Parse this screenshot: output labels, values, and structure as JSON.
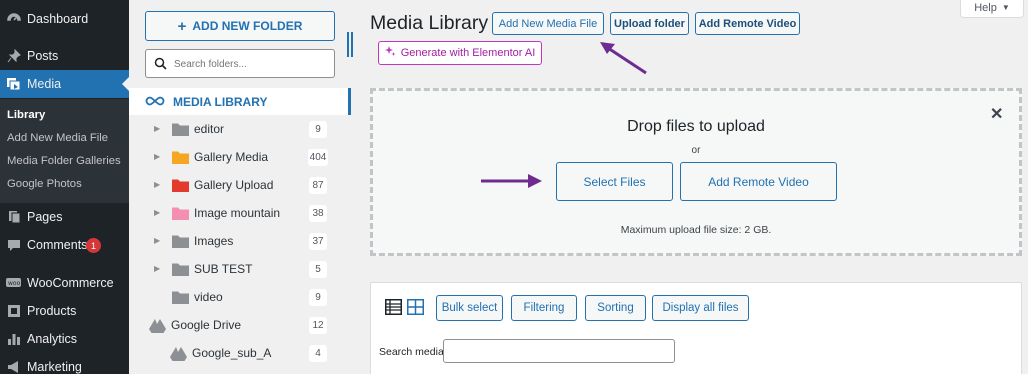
{
  "colors": {
    "accent": "#2271b1",
    "sidebar_bg": "#1d2327",
    "annotation": "#6e2c91",
    "elementor": "#c036c0"
  },
  "admin_menu": {
    "items": [
      {
        "label": "Dashboard",
        "icon": "dashboard-icon"
      },
      {
        "label": "Posts",
        "icon": "pin-icon"
      },
      {
        "label": "Media",
        "icon": "media-icon"
      },
      {
        "label": "Pages",
        "icon": "page-icon"
      },
      {
        "label": "Comments",
        "icon": "comment-icon",
        "badge": "1"
      },
      {
        "label": "WooCommerce",
        "icon": "woocommerce-icon"
      },
      {
        "label": "Products",
        "icon": "products-icon"
      },
      {
        "label": "Analytics",
        "icon": "analytics-icon"
      },
      {
        "label": "Marketing",
        "icon": "marketing-icon"
      }
    ],
    "submenu": [
      "Library",
      "Add New Media File",
      "Media Folder Galleries",
      "Google Photos"
    ]
  },
  "folders": {
    "add_button": "ADD NEW FOLDER",
    "search_placeholder": "Search folders...",
    "media_library": "MEDIA LIBRARY",
    "items": [
      {
        "label": "editor",
        "count": "9",
        "color": "#8c8f94"
      },
      {
        "label": "Gallery Media",
        "count": "404",
        "color": "#f5a623"
      },
      {
        "label": "Gallery Upload",
        "count": "87",
        "color": "#e23b2e"
      },
      {
        "label": "Image mountain",
        "count": "38",
        "color": "#f48fb1"
      },
      {
        "label": "Images",
        "count": "37",
        "color": "#8c8f94"
      },
      {
        "label": "SUB TEST",
        "count": "5",
        "color": "#8c8f94"
      },
      {
        "label": "video",
        "count": "9",
        "color": "#8c8f94"
      }
    ],
    "google_drive": {
      "label": "Google Drive",
      "count": "12"
    },
    "google_sub": {
      "label": "Google_sub_A",
      "count": "4"
    }
  },
  "header": {
    "title": "Media Library",
    "add_new": "Add New Media File",
    "upload_folder": "Upload folder",
    "add_remote": "Add Remote Video",
    "elementor": "Generate with Elementor AI",
    "help": "Help"
  },
  "uploader": {
    "title": "Drop files to upload",
    "or": "or",
    "select_files": "Select Files",
    "add_remote": "Add Remote Video",
    "max_size": "Maximum upload file size: 2 GB."
  },
  "toolbar": {
    "bulk_select": "Bulk select",
    "filtering": "Filtering",
    "sorting": "Sorting",
    "display_all": "Display all files",
    "search_label": "Search media"
  }
}
